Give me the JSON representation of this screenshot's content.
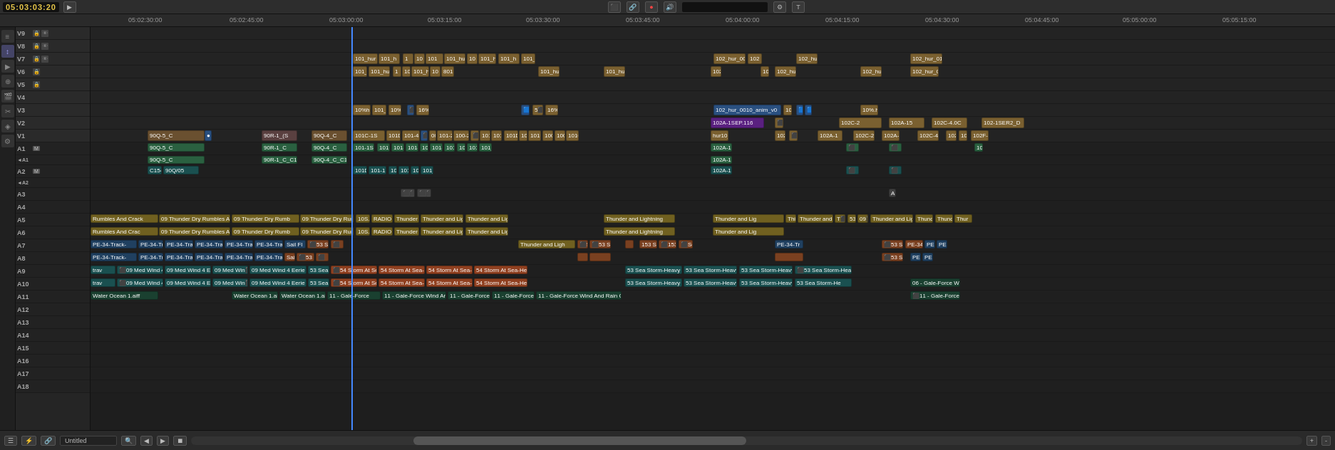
{
  "toolbar": {
    "timecode": "05:03:03:20",
    "buttons": [
      "◀◀",
      "◀",
      "▶",
      "▶▶",
      "●"
    ],
    "icons": [
      "📋",
      "🔗",
      "●",
      "🔊"
    ],
    "zoom_label": "Untitled"
  },
  "ruler": {
    "marks": [
      {
        "label": "05:02:30:00",
        "pos": 180
      },
      {
        "label": "05:02:45:00",
        "pos": 322
      },
      {
        "label": "05:03:00:00",
        "pos": 462
      },
      {
        "label": "05:03:15:00",
        "pos": 600
      },
      {
        "label": "05:03:30:00",
        "pos": 738
      },
      {
        "label": "05:03:45:00",
        "pos": 878
      },
      {
        "label": "05:04:00:00",
        "pos": 1018
      },
      {
        "label": "05:04:15:00",
        "pos": 1158
      },
      {
        "label": "05:04:30:00",
        "pos": 1298
      },
      {
        "label": "05:04:45:00",
        "pos": 1438
      },
      {
        "label": "05:05:00:00",
        "pos": 1575
      },
      {
        "label": "05:05:15:00",
        "pos": 1715
      }
    ]
  },
  "tracks": [
    {
      "id": "V9",
      "type": "video",
      "label": "V9"
    },
    {
      "id": "V8",
      "type": "video",
      "label": "V8"
    },
    {
      "id": "V7",
      "type": "video",
      "label": "V7"
    },
    {
      "id": "V6",
      "type": "video",
      "label": "V6"
    },
    {
      "id": "V5",
      "type": "video",
      "label": "V5"
    },
    {
      "id": "V4",
      "type": "video",
      "label": "V4"
    },
    {
      "id": "V3",
      "type": "video",
      "label": "V3"
    },
    {
      "id": "V2",
      "type": "video",
      "label": "V2"
    },
    {
      "id": "V1",
      "type": "video",
      "label": "V1"
    },
    {
      "id": "A1",
      "type": "audio",
      "label": "A1"
    },
    {
      "id": "A2",
      "type": "audio",
      "label": "A2"
    },
    {
      "id": "A3",
      "type": "audio",
      "label": "A3"
    },
    {
      "id": "A4",
      "type": "audio",
      "label": "A4"
    },
    {
      "id": "A5",
      "type": "audio",
      "label": "A5"
    },
    {
      "id": "A6",
      "type": "audio",
      "label": "A6"
    },
    {
      "id": "A7",
      "type": "audio",
      "label": "A7"
    },
    {
      "id": "A8",
      "type": "audio",
      "label": "A8"
    },
    {
      "id": "A9",
      "type": "audio",
      "label": "A9"
    },
    {
      "id": "A10",
      "type": "audio",
      "label": "A10"
    },
    {
      "id": "A11",
      "type": "audio",
      "label": "A11"
    },
    {
      "id": "A12",
      "type": "audio",
      "label": "A12"
    },
    {
      "id": "A13",
      "type": "audio",
      "label": "A13"
    },
    {
      "id": "A14",
      "type": "audio",
      "label": "A14"
    },
    {
      "id": "A15",
      "type": "audio",
      "label": "A15"
    },
    {
      "id": "A16",
      "type": "audio",
      "label": "A16"
    },
    {
      "id": "A17",
      "type": "audio",
      "label": "A17"
    },
    {
      "id": "A18",
      "type": "audio",
      "label": "A18"
    }
  ],
  "side_icons": [
    "≡",
    "↕",
    "▶",
    "⊕",
    "🎬",
    "✂",
    "◈",
    "⚙"
  ],
  "bottom": {
    "project_name": "Untitled",
    "nav_prev": "◀",
    "nav_next": "▶",
    "nav_end": "⏹"
  }
}
